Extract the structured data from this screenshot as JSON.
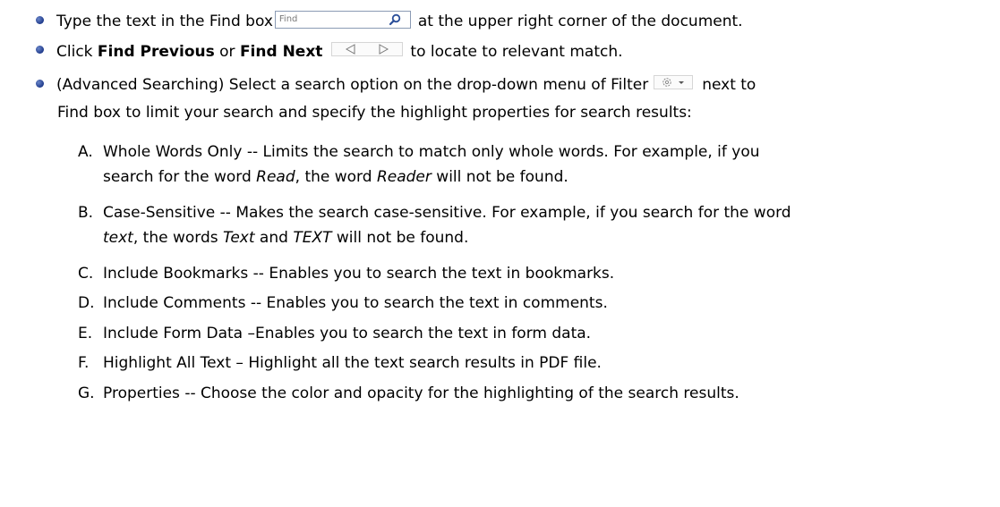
{
  "bullets": [
    {
      "pre": "Type the text in the Find box",
      "find_placeholder": "Find",
      "post": "at the upper right corner of the document."
    },
    {
      "pre": "Click ",
      "bold1": "Find Previous",
      "mid": " or ",
      "bold2": "Find Next",
      "post": "to locate to relevant match."
    },
    {
      "line1_pre": "(Advanced Searching) Select a search option on the drop-down menu of Filter",
      "line1_post": "next to",
      "line2": "Find box to limit your search and specify the highlight properties for search results:"
    }
  ],
  "options": [
    {
      "letter": "A.",
      "line1": "Whole Words Only -- Limits the search to match only whole words. For example, if you",
      "line2_pre": "search for the word ",
      "i1": "Read",
      "line2_mid": ", the word ",
      "i2": "Reader",
      "line2_post": " will not be found."
    },
    {
      "letter": "B.",
      "line1": "Case-Sensitive -- Makes the search case-sensitive. For example, if you search for the word",
      "i0": "text",
      "line2_pre": ", the words ",
      "i1": "Text",
      "line2_mid": " and ",
      "i2": "TEXT",
      "line2_post": " will not be found."
    },
    {
      "letter": "C.",
      "text": "Include Bookmarks -- Enables you to search the text in bookmarks."
    },
    {
      "letter": "D.",
      "text": "Include Comments -- Enables you to search the text in comments."
    },
    {
      "letter": "E.",
      "text": "Include Form Data –Enables you to search the text in form data."
    },
    {
      "letter": "F.",
      "text": "Highlight All Text – Highlight all the text search results in PDF file."
    },
    {
      "letter": "G.",
      "text": "Properties -- Choose the color and opacity for the highlighting of the search results."
    }
  ],
  "icons": {
    "bullet": "bullet-dot",
    "find_box_search": "magnifier-icon",
    "find_prev": "triangle-left-icon",
    "find_next": "triangle-right-icon",
    "filter": "filter-gear-dropdown-icon"
  },
  "colors": {
    "bullet": "#1f3b8c",
    "find_box_border": "#8b9bb4"
  }
}
